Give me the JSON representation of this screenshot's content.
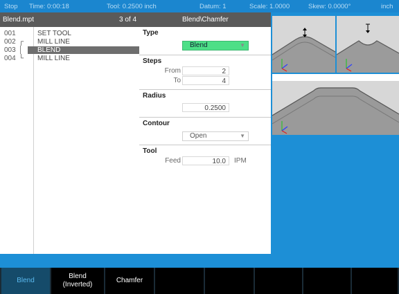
{
  "status": {
    "mode": "Stop",
    "time": "Time: 0:00:18",
    "tool": "Tool: 0.2500 inch",
    "datum": "Datum: 1",
    "scale": "Scale: 1.0000",
    "skew": "Skew: 0.0000°",
    "units": "inch"
  },
  "list": {
    "filename": "Blend.mpt",
    "position": "3 of 4",
    "items": [
      {
        "num": "001",
        "bracket": "",
        "label": "SET TOOL"
      },
      {
        "num": "002",
        "bracket": "┌",
        "label": "MILL LINE"
      },
      {
        "num": "003",
        "bracket": "│",
        "label": "BLEND"
      },
      {
        "num": "004",
        "bracket": "└",
        "label": "MILL LINE"
      }
    ]
  },
  "form": {
    "title": "Blend\\Chamfer",
    "type": {
      "label": "Type",
      "value": "Blend"
    },
    "steps": {
      "label": "Steps",
      "from_label": "From",
      "from_value": "2",
      "to_label": "To",
      "to_value": "4"
    },
    "radius": {
      "label": "Radius",
      "value": "0.2500"
    },
    "contour": {
      "label": "Contour",
      "value": "Open"
    },
    "tool": {
      "label": "Tool",
      "feed_label": "Feed",
      "feed_value": "10.0",
      "feed_unit": "IPM"
    }
  },
  "softkeys": [
    {
      "label": "Blend",
      "label2": "",
      "active": true
    },
    {
      "label": "Blend",
      "label2": "(Inverted)",
      "active": false
    },
    {
      "label": "Chamfer",
      "label2": "",
      "active": false
    },
    {
      "label": "",
      "label2": "",
      "active": false
    },
    {
      "label": "",
      "label2": "",
      "active": false
    },
    {
      "label": "",
      "label2": "",
      "active": false
    },
    {
      "label": "",
      "label2": "",
      "active": false
    },
    {
      "label": "",
      "label2": "",
      "active": false
    }
  ],
  "colors": {
    "accent": "#1d8fd6",
    "active_field": "#4ddf87",
    "softkey_active": "#154b6a"
  }
}
